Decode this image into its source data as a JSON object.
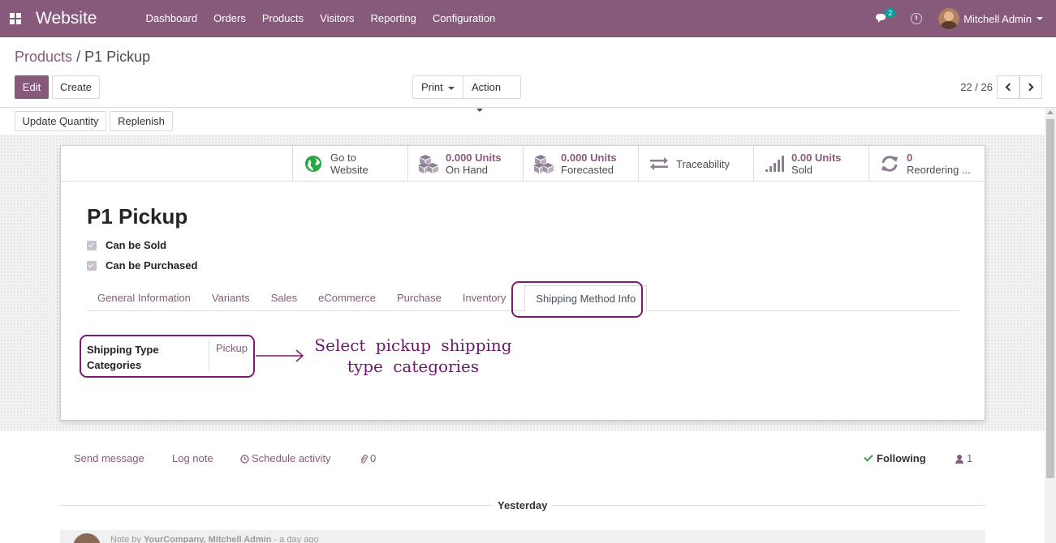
{
  "navbar": {
    "brand": "Website",
    "menu": [
      "Dashboard",
      "Orders",
      "Products",
      "Visitors",
      "Reporting",
      "Configuration"
    ],
    "chat_badge": "2",
    "user_name": "Mitchell Admin",
    "color": "#875a7b"
  },
  "breadcrumb": {
    "parent": "Products",
    "separator": "/",
    "current": "P1 Pickup"
  },
  "toolbar": {
    "edit": "Edit",
    "create": "Create",
    "print": "Print",
    "action": "Action",
    "pager": "22 / 26",
    "update_quantity": "Update Quantity",
    "replenish": "Replenish"
  },
  "smart_buttons": [
    {
      "value": "Go to",
      "label": "Website",
      "icon": "globe-icon"
    },
    {
      "value": "0.000 Units",
      "label": "On Hand",
      "icon": "cubes-icon"
    },
    {
      "value": "0.000 Units",
      "label": "Forecasted",
      "icon": "cubes-icon"
    },
    {
      "value": "",
      "label": "Traceability",
      "icon": "exchange-icon"
    },
    {
      "value": "0.00 Units",
      "label": "Sold",
      "icon": "signal-icon"
    },
    {
      "value": "0",
      "label": "Reordering ...",
      "icon": "refresh-icon"
    }
  ],
  "form": {
    "title": "P1 Pickup",
    "can_be_sold": "Can be Sold",
    "can_be_purchased": "Can be Purchased",
    "tabs": [
      "General Information",
      "Variants",
      "Sales",
      "eCommerce",
      "Purchase",
      "Inventory",
      "Shipping Method Info"
    ],
    "active_tab": "Shipping Method Info",
    "field_label": "Shipping Type Categories",
    "field_value": "Pickup",
    "annotation": "Select pickup shipping type categories",
    "highlight_color": "#7b1b73"
  },
  "chatter": {
    "send_message": "Send message",
    "log_note": "Log note",
    "schedule_activity": "Schedule activity",
    "attachments": "0",
    "following": "Following",
    "followers": "1",
    "day": "Yesterday",
    "note_prefix": "Note by",
    "note_author": "YourCompany, Mitchell Admin",
    "note_time": "- a day ago"
  }
}
